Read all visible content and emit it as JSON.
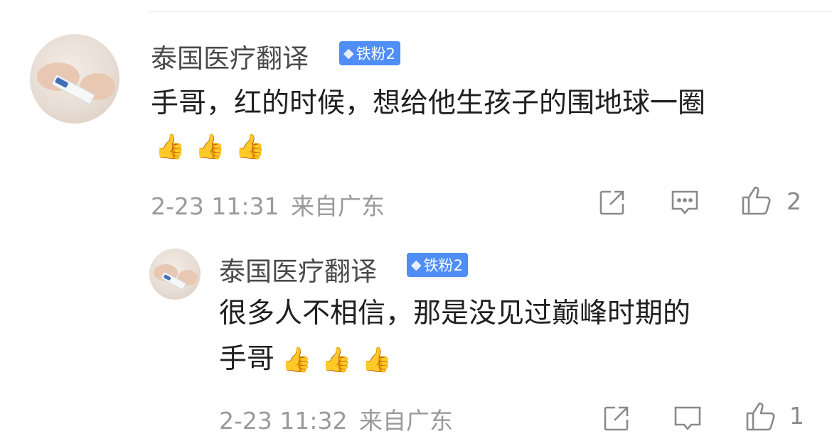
{
  "comments": [
    {
      "author": "泰国医疗翻译",
      "badge": "铁粉2",
      "text_line1": "手哥，红的时候，想给他生孩子的围地球一圈",
      "emojis": [
        "👍",
        "👍",
        "👍"
      ],
      "date": "2-23",
      "time": "11:31",
      "location": "来自广东",
      "likes": "2"
    },
    {
      "author": "泰国医疗翻译",
      "badge": "铁粉2",
      "text_line1": "很多人不相信，那是没见过巅峰时期的",
      "text_line2": "手哥",
      "emojis": [
        "👍",
        "👍",
        "👍"
      ],
      "date": "2-23",
      "time": "11:32",
      "location": "来自广东",
      "likes": "1"
    }
  ],
  "icons": {
    "share": "share-icon",
    "reply": "reply-comment-icon",
    "like": "thumbs-up-icon",
    "badge_gem": "diamond-icon"
  },
  "colors": {
    "badge_bg": "#4f8ef6",
    "name": "#4a4a4a",
    "meta": "#9a9a9a"
  }
}
